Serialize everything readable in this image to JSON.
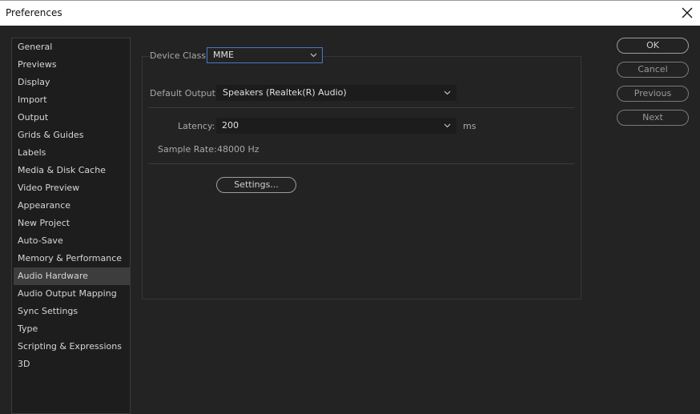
{
  "window": {
    "title": "Preferences"
  },
  "sidebar": {
    "items": [
      {
        "label": "General"
      },
      {
        "label": "Previews"
      },
      {
        "label": "Display"
      },
      {
        "label": "Import"
      },
      {
        "label": "Output"
      },
      {
        "label": "Grids & Guides"
      },
      {
        "label": "Labels"
      },
      {
        "label": "Media & Disk Cache"
      },
      {
        "label": "Video Preview"
      },
      {
        "label": "Appearance"
      },
      {
        "label": "New Project"
      },
      {
        "label": "Auto-Save"
      },
      {
        "label": "Memory & Performance"
      },
      {
        "label": "Audio Hardware",
        "selected": true
      },
      {
        "label": "Audio Output Mapping"
      },
      {
        "label": "Sync Settings"
      },
      {
        "label": "Type"
      },
      {
        "label": "Scripting & Expressions"
      },
      {
        "label": "3D"
      }
    ]
  },
  "audio": {
    "device_class_label": "Device Class:",
    "device_class_value": "MME",
    "default_output_label": "Default Output:",
    "default_output_value": "Speakers (Realtek(R) Audio)",
    "latency_label": "Latency:",
    "latency_value": "200",
    "latency_unit": "ms",
    "sample_rate_label": "Sample Rate:",
    "sample_rate_value": "48000 Hz",
    "settings_button": "Settings..."
  },
  "buttons": {
    "ok": "OK",
    "cancel": "Cancel",
    "previous": "Previous",
    "next": "Next"
  },
  "colors": {
    "background": "#232323",
    "focus_border": "#4a78c8",
    "selected_item": "#3d3d3d"
  }
}
